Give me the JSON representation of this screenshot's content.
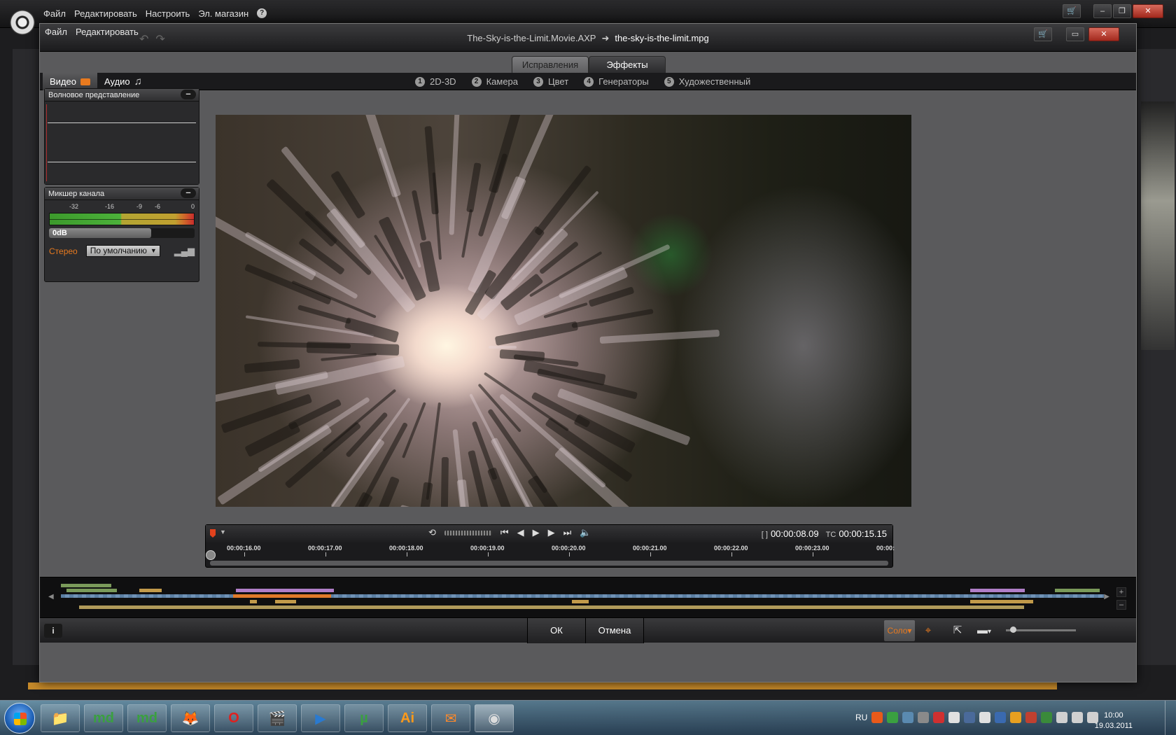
{
  "background_app": {
    "menu": [
      "Файл",
      "Редактировать",
      "Настроить",
      "Эл. магазин"
    ],
    "help_glyph": "?",
    "window_buttons": {
      "cart": "🛒",
      "minimize": "–",
      "restore": "❐",
      "close": "✕"
    }
  },
  "dialog": {
    "menu": [
      "Файл",
      "Редактировать"
    ],
    "undo_glyph": "↶",
    "redo_glyph": "↷",
    "project_file": "The-Sky-is-the-Limit.Movie.AXP",
    "arrow": "➜",
    "media_file": "the-sky-is-the-limit.mpg",
    "window_buttons": {
      "cart": "🛒",
      "maximize": "▭",
      "close": "✕"
    },
    "top_tabs": [
      {
        "label": "Исправления",
        "active": false
      },
      {
        "label": "Эффекты",
        "active": true
      }
    ],
    "media_tabs": [
      {
        "label": "Видео",
        "icon": "camera-icon",
        "active": true
      },
      {
        "label": "Аудио",
        "icon": "music-note-icon",
        "active": false
      }
    ],
    "effect_categories": [
      {
        "num": "1",
        "label": "2D-3D"
      },
      {
        "num": "2",
        "label": "Камера"
      },
      {
        "num": "3",
        "label": "Цвет"
      },
      {
        "num": "4",
        "label": "Генераторы"
      },
      {
        "num": "5",
        "label": "Художественный"
      }
    ],
    "waveform_panel": {
      "title": "Волновое представление",
      "collapse": "–"
    },
    "mixer_panel": {
      "title": "Микшер канала",
      "collapse": "–",
      "scale": [
        "-32",
        "-16",
        "-9",
        "-6",
        "0"
      ],
      "volume_label": "0dB",
      "channel_label": "Стерео",
      "channel_select": "По умолчанию",
      "select_caret": "▼"
    },
    "player": {
      "marker_caret": "▼",
      "transport": {
        "loop": "⟲",
        "to_start": "⏮",
        "prev_frame": "◀",
        "play": "▶",
        "next_frame": "▶",
        "to_end": "⏭",
        "volume": "🔈"
      },
      "current_label": "[ ]",
      "current_time": "00:00:08.09",
      "total_label": "TC",
      "total_time": "00:00:15.15",
      "ruler": [
        "00:00:16.00",
        "00:00:17.00",
        "00:00:18.00",
        "00:00:19.00",
        "00:00:20.00",
        "00:00:21.00",
        "00:00:22.00",
        "00:00:23.00",
        "00:00:"
      ]
    },
    "overview": {
      "left_arrow": "◀",
      "right_arrow": "▶",
      "zoom_in": "+",
      "zoom_out": "–"
    },
    "bottom": {
      "info": "i",
      "ok": "ОК",
      "cancel": "Отмена",
      "solo": "Соло",
      "solo_caret": "▾",
      "target_glyph": "⌖",
      "export_glyph": "⇱",
      "display_glyph": "▬",
      "display_caret": "▾"
    }
  },
  "taskbar": {
    "apps": [
      {
        "name": "explorer",
        "glyph": "📁"
      },
      {
        "name": "md-1",
        "glyph": "md"
      },
      {
        "name": "md-2",
        "glyph": "md"
      },
      {
        "name": "firefox",
        "glyph": "🦊"
      },
      {
        "name": "opera",
        "glyph": "O"
      },
      {
        "name": "studio-pro",
        "glyph": "🎬"
      },
      {
        "name": "media-player",
        "glyph": "▶"
      },
      {
        "name": "utorrent",
        "glyph": "µ"
      },
      {
        "name": "illustrator",
        "glyph": "Ai"
      },
      {
        "name": "mail",
        "glyph": "✉"
      },
      {
        "name": "pinnacle",
        "glyph": "◉"
      }
    ],
    "language": "RU",
    "time": "10:00",
    "date": "19.03.2011"
  },
  "colors": {
    "accent_orange": "#e87a1f",
    "record_red": "#e2421d"
  }
}
